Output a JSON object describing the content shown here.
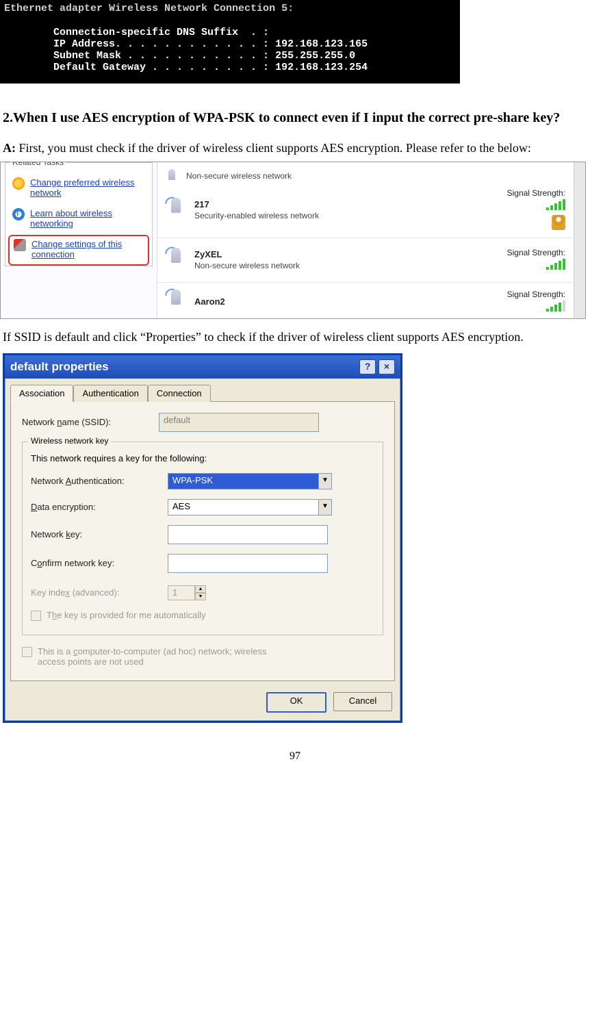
{
  "terminal": {
    "adapter_line": "Ethernet adapter Wireless Network Connection 5:",
    "dns_label": "        Connection-specific DNS Suffix  . :",
    "ip_label": "        IP Address. . . . . . . . . . . . : ",
    "ip_value": "192.168.123.165",
    "mask_label": "        Subnet Mask . . . . . . . . . . . : ",
    "mask_value": "255.255.255.0",
    "gw_label": "        Default Gateway . . . . . . . . . : ",
    "gw_value": "192.168.123.254"
  },
  "question": "2.When I use AES encryption of WPA-PSK to connect even if I input the correct pre-share key?",
  "answer_prefix": "A:",
  "answer_body": " First, you must check if the driver of wireless client supports AES encryption. Please refer to the below:",
  "wl": {
    "related_title": "Related Tasks",
    "task1": "Change preferred wireless network",
    "task2": "Learn about wireless networking",
    "task3": "Change settings of this connection",
    "nets": [
      {
        "name": "",
        "desc": "Non-secure wireless network",
        "ss": "",
        "bars": 0,
        "lock": false
      },
      {
        "name": "217",
        "desc": "Security-enabled wireless network",
        "ss": "Signal Strength:",
        "bars": 5,
        "lock": true
      },
      {
        "name": "ZyXEL",
        "desc": "Non-secure wireless network",
        "ss": "Signal Strength:",
        "bars": 5,
        "lock": false
      },
      {
        "name": "Aaron2",
        "desc": "",
        "ss": "Signal Strength:",
        "bars": 4,
        "lock": false
      }
    ]
  },
  "mid_text": "If SSID is default and click “Properties” to check if the driver of wireless client supports AES encryption.",
  "dlg": {
    "title": "default properties",
    "help": "?",
    "close": "×",
    "tabs": {
      "assoc": "Association",
      "auth": "Authentication",
      "conn": "Connection"
    },
    "ssid_label": "Network name (SSID):",
    "ssid_value": "default",
    "group_label": "Wireless network key",
    "group_text": "This network requires a key for the following:",
    "auth_label": "Network Authentication:",
    "auth_value": "WPA-PSK",
    "enc_label": "Data encryption:",
    "enc_value": "AES",
    "key_label": "Network key:",
    "confirm_label": "Confirm network key:",
    "keyidx_label": "Key index (advanced):",
    "keyidx_value": "1",
    "auto_label": "The key is provided for me automatically",
    "adhoc_label": "This is a computer-to-computer (ad hoc) network; wireless access points are not used",
    "ok": "OK",
    "cancel": "Cancel"
  },
  "page_number": "97"
}
